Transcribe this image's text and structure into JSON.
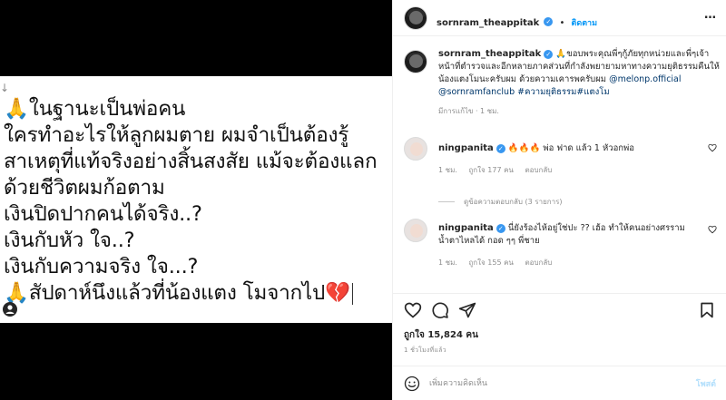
{
  "media": {
    "arrow_glyph": "↓",
    "lines": [
      "🙏ในฐานะเป็นพ่อคน",
      "ใครทำอะไรให้ลูกผมตาย ผมจำเป็นต้องรู้",
      "สาเหตุที่แท้จริงอย่างสิ้นสงสัย แม้จะต้องแลก",
      "ด้วยชีวิตผมก้อตาม",
      "เงินปิดปากคนได้จริง..?",
      "เงินกับหัว ใจ..?",
      "เงินกับความจริง ใจ...?",
      "🙏สัปดาห์นึงแล้วที่น้องแตง โมจากไป💔"
    ]
  },
  "header": {
    "username": "sornram_theappitak",
    "verified_mark": "✓",
    "separator": "•",
    "follow_label": "ติดตาม",
    "more_icon": "…"
  },
  "caption": {
    "username": "sornram_theappitak",
    "verified_mark": "✓",
    "text_1": "🙏ขอบพระคุณพี่ๆกู้ภัยทุกหน่วยและพี่ๆเจ้าหน้าที่ตำรวจและอีกหลายภาคส่วนที่กำลังพยายามหาทางความยุติธรรมคืนให้น้องแตงโมนะครับผม ด้วยความเคารพครับผม",
    "mention_1": "@melonp.official",
    "mention_2": "@sornramfanclub",
    "hashtags": "#ความยุติธรรม#แตงโม",
    "edited": "มีการแก้ไข · 1 ชม."
  },
  "comments": [
    {
      "username": "ningpanita",
      "verified_mark": "✓",
      "text": "🔥🔥🔥 พ่อ ฟาด แล้ว 1 หัวอกพ่อ",
      "time": "1 ชม.",
      "likes": "ถูกใจ 177 คน",
      "reply": "ตอบกลับ"
    },
    {
      "username": "ningpanita",
      "verified_mark": "✓",
      "text": "นี่ยังร้องไห้อยู่ใช่ปะ ?? เฮ้อ ทำให้คนอย่างศรรามน้ำตาไหลได้ กอด ๆๆ พี่ชาย",
      "time": "1 ชม.",
      "likes": "ถูกใจ 155 คน",
      "reply": "ตอบกลับ"
    }
  ],
  "view_replies": "ดูข้อความตอบกลับ (3 รายการ)",
  "actions": {
    "like_count": "ถูกใจ 15,824 คน",
    "time_ago": "1 ชั่วโมงที่แล้ว"
  },
  "composer": {
    "placeholder": "เพิ่มความคิดเห็น",
    "post_label": "โพสต์"
  }
}
